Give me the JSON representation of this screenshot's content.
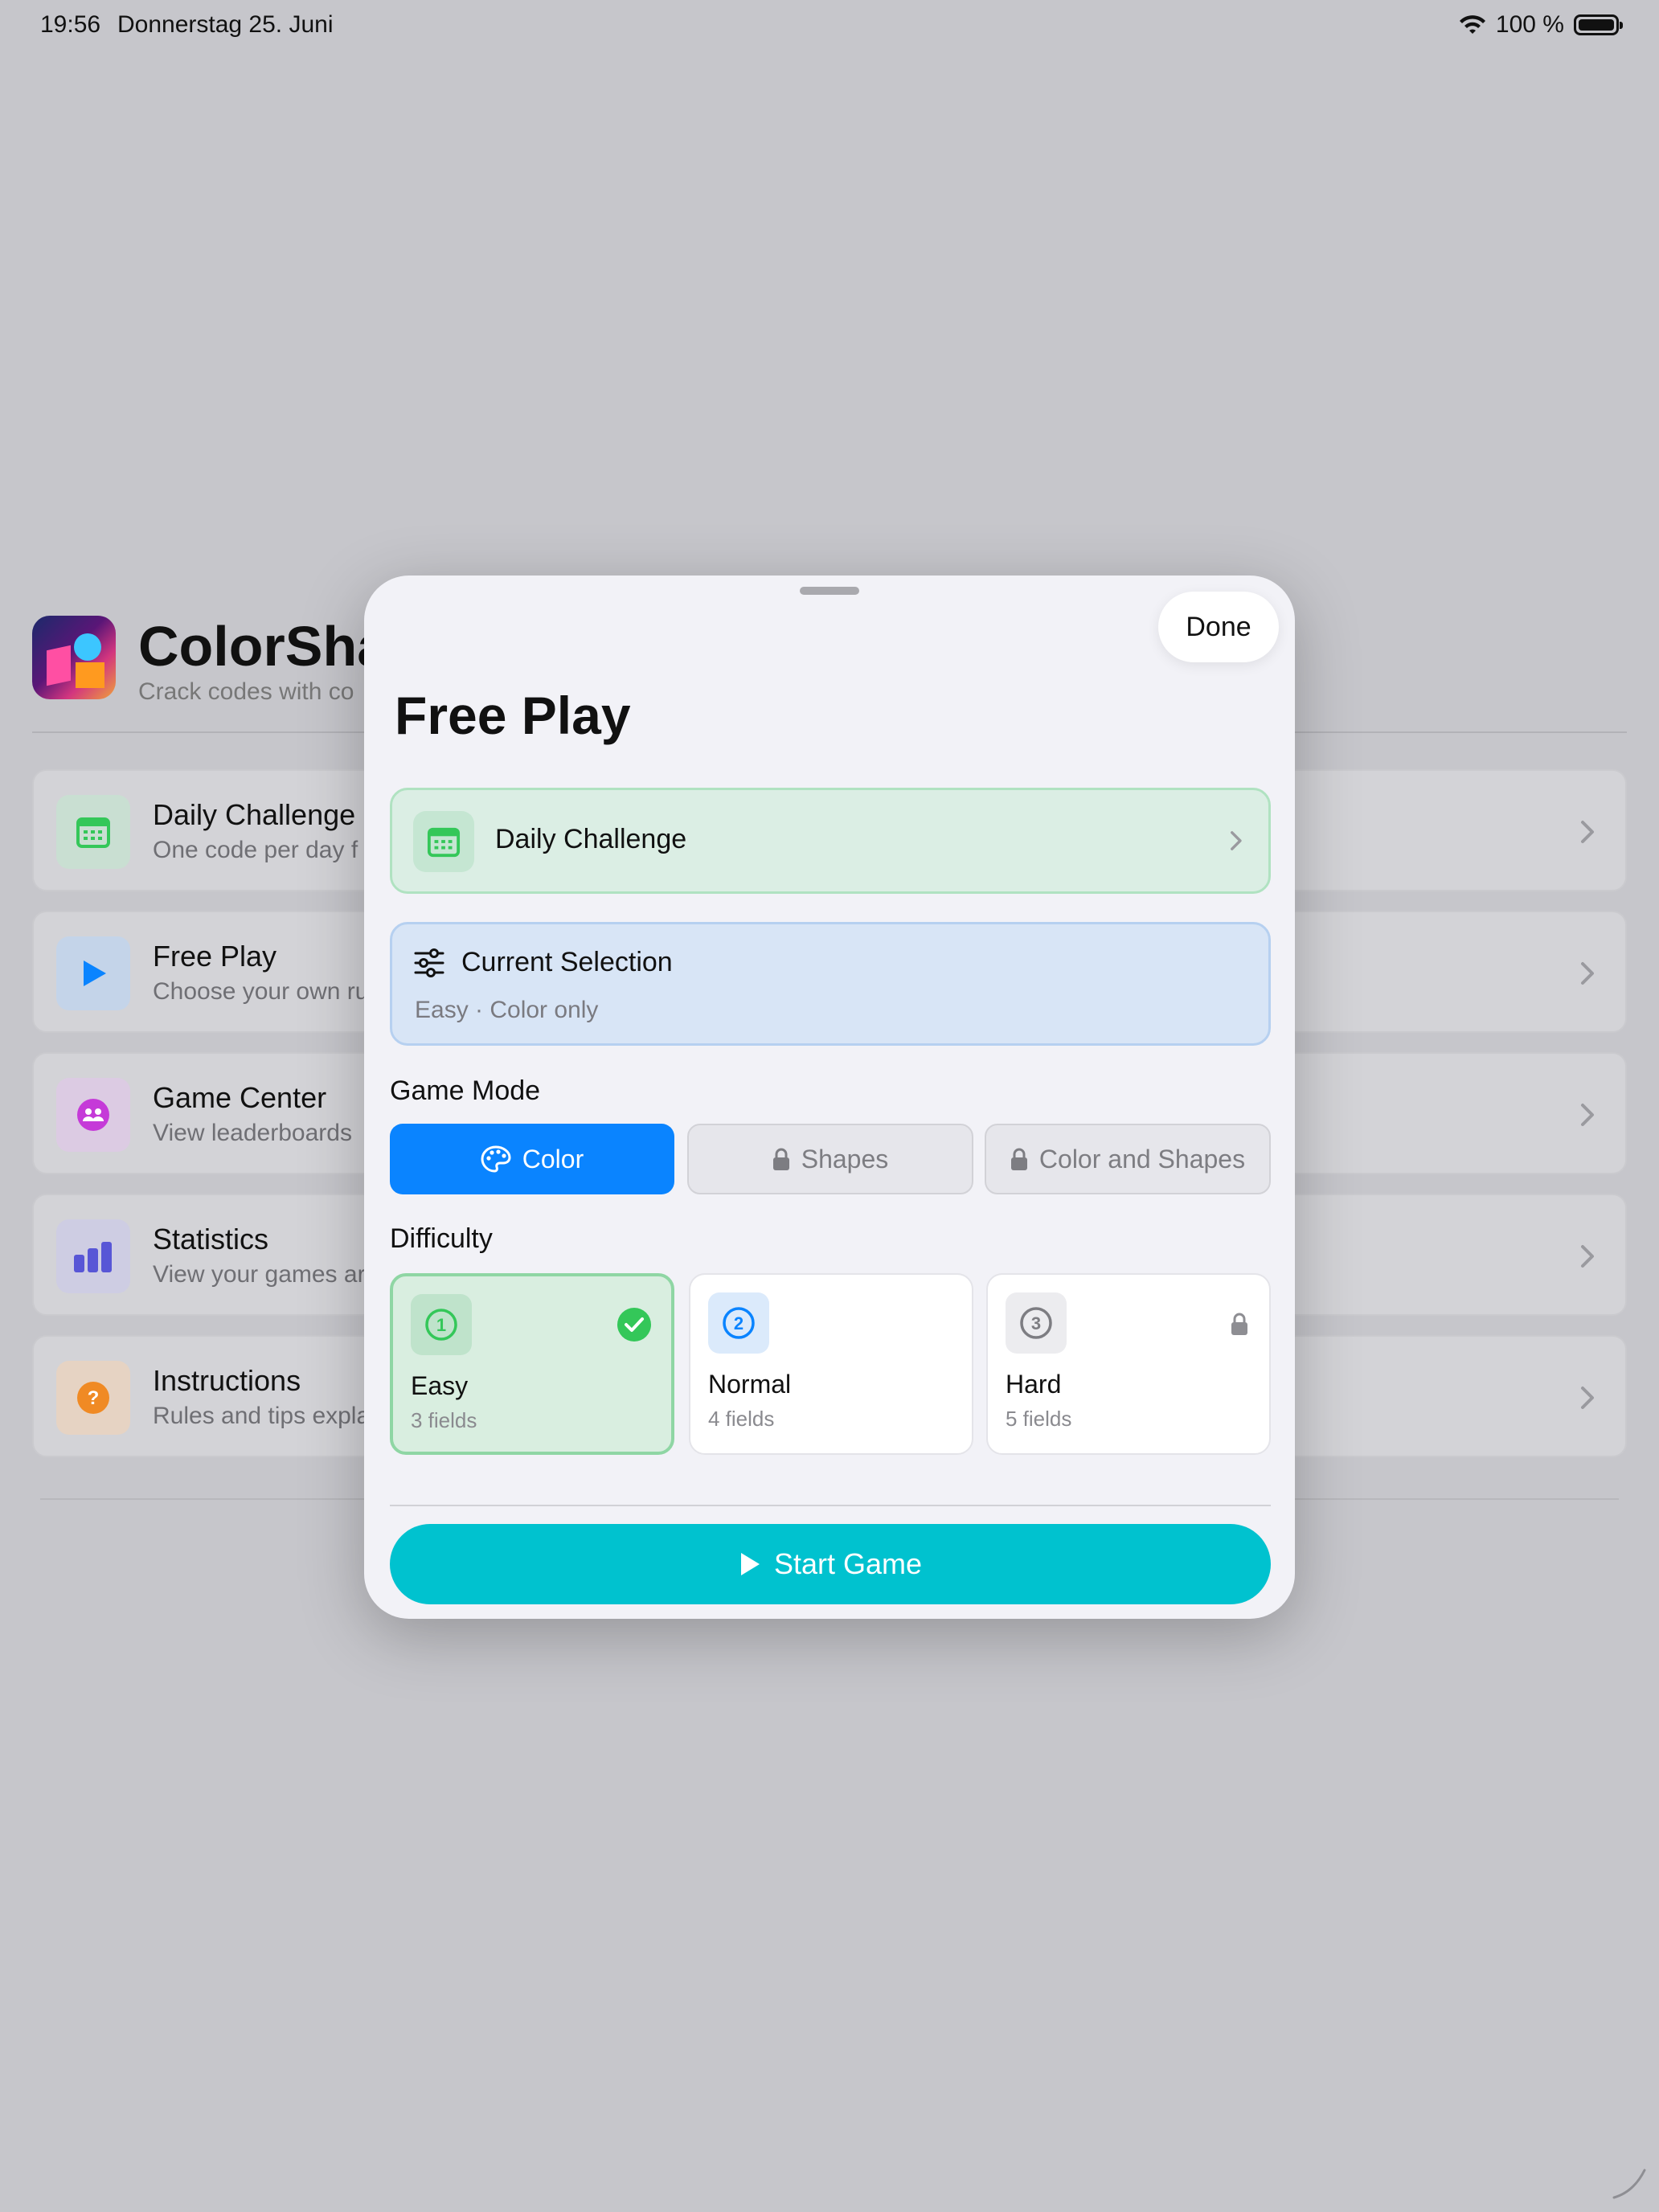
{
  "status_bar": {
    "time": "19:56",
    "date": "Donnerstag 25. Juni",
    "battery_label": "100 %",
    "icons": [
      "wifi-icon",
      "battery-icon"
    ]
  },
  "background_app": {
    "title": "ColorSha",
    "subtitle": "Crack codes with co",
    "menu": [
      {
        "title": "Daily Challenge",
        "subtitle": "One code per day f",
        "icon": "calendar-icon",
        "color": "#34c759"
      },
      {
        "title": "Free Play",
        "subtitle": "Choose your own ru",
        "icon": "play-icon",
        "color": "#0a84ff"
      },
      {
        "title": "Game Center",
        "subtitle": "View leaderboards",
        "icon": "people-icon",
        "color": "#c53ad8"
      },
      {
        "title": "Statistics",
        "subtitle": "View your games ar",
        "icon": "bar-chart-icon",
        "color": "#5856d6"
      },
      {
        "title": "Instructions",
        "subtitle": "Rules and tips expla",
        "icon": "question-icon",
        "color": "#f08a24"
      }
    ]
  },
  "modal": {
    "done_label": "Done",
    "title": "Free Play",
    "daily_challenge_label": "Daily Challenge",
    "current_selection": {
      "title": "Current Selection",
      "summary": "Easy · Color only"
    },
    "game_mode": {
      "label": "Game Mode",
      "options": [
        {
          "label": "Color",
          "state": "selected",
          "icon": "palette-icon"
        },
        {
          "label": "Shapes",
          "state": "locked",
          "icon": "lock-icon"
        },
        {
          "label": "Color and Shapes",
          "state": "locked",
          "icon": "lock-icon"
        }
      ]
    },
    "difficulty": {
      "label": "Difficulty",
      "options": [
        {
          "number": "1",
          "name": "Easy",
          "fields": "3 fields",
          "state": "selected",
          "color": "#34c759"
        },
        {
          "number": "2",
          "name": "Normal",
          "fields": "4 fields",
          "state": "available",
          "color": "#0a84ff"
        },
        {
          "number": "3",
          "name": "Hard",
          "fields": "5 fields",
          "state": "locked",
          "color": "#7d7d82"
        }
      ]
    },
    "start_label": "Start Game"
  },
  "colors": {
    "accent_blue": "#0a84ff",
    "accent_green": "#34c759",
    "start_button": "#00c2cf"
  }
}
